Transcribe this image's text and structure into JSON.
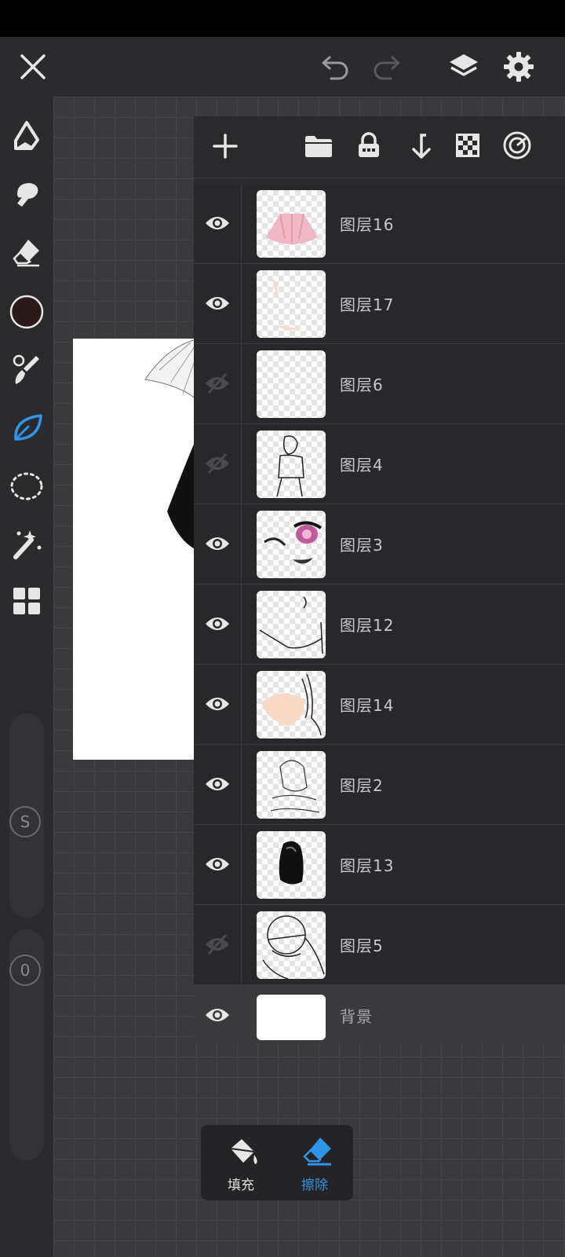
{
  "colors": {
    "accent": "#2f95e8",
    "icon": "#e6e6e6",
    "current_color": "#2a1a1a"
  },
  "topbar": {
    "close_icon": "close-icon",
    "undo_icon": "undo-icon",
    "redo_icon": "redo-icon",
    "layers_icon": "layers-icon",
    "settings_icon": "gear-icon"
  },
  "tools": [
    {
      "name": "pencil-tool",
      "icon": "pen-nib-icon",
      "active": false
    },
    {
      "name": "smudge-tool",
      "icon": "smudge-icon",
      "active": false
    },
    {
      "name": "eraser-tool",
      "icon": "eraser-icon",
      "active": false
    },
    {
      "name": "color-picker",
      "icon": "color-swatch",
      "active": false
    },
    {
      "name": "brush-tool",
      "icon": "brush-icon",
      "active": false
    },
    {
      "name": "leaf-tool",
      "icon": "leaf-icon",
      "active": true
    },
    {
      "name": "lasso-tool",
      "icon": "lasso-icon",
      "active": false
    },
    {
      "name": "magic-wand-tool",
      "icon": "magic-wand-icon",
      "active": false
    },
    {
      "name": "grid-tool",
      "icon": "grid-icon",
      "active": false
    }
  ],
  "sliders": {
    "size_badge": "S",
    "opacity_badge": "0"
  },
  "layer_panel": {
    "toolbar": [
      "add-layer-icon",
      "folder-icon",
      "lock-icon",
      "merge-down-icon",
      "alpha-lock-icon",
      "blend-icon"
    ],
    "layers": [
      {
        "name": "图层16",
        "visible": true
      },
      {
        "name": "图层17",
        "visible": true
      },
      {
        "name": "图层6",
        "visible": false
      },
      {
        "name": "图层4",
        "visible": false
      },
      {
        "name": "图层3",
        "visible": true
      },
      {
        "name": "图层12",
        "visible": true
      },
      {
        "name": "图层14",
        "visible": true
      },
      {
        "name": "图层2",
        "visible": true
      },
      {
        "name": "图层13",
        "visible": true
      },
      {
        "name": "图层5",
        "visible": false
      },
      {
        "name": "背景",
        "visible": true
      }
    ]
  },
  "bottom_bar": {
    "fill_label": "填充",
    "erase_label": "擦除"
  }
}
